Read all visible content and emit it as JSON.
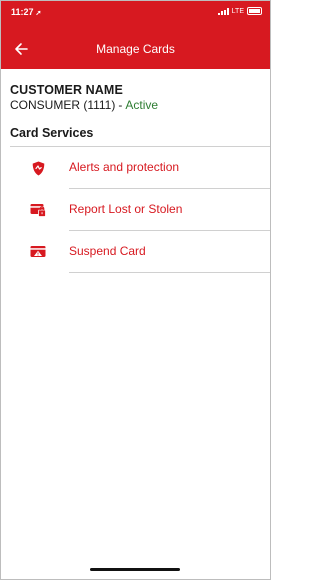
{
  "status_bar": {
    "time": "11:27",
    "network": "LTE"
  },
  "header": {
    "title": "Manage Cards"
  },
  "customer": {
    "name_label": "CUSTOMER NAME",
    "account": "CONSUMER (1111)",
    "separator": "-",
    "status": "Active"
  },
  "card_services": {
    "title": "Card Services",
    "items": [
      {
        "label": "Alerts and protection",
        "icon": "shield-icon"
      },
      {
        "label": "Report Lost or Stolen",
        "icon": "card-lock-icon"
      },
      {
        "label": "Suspend Card",
        "icon": "card-suspend-icon"
      }
    ]
  },
  "colors": {
    "brand_red": "#d71920",
    "active_green": "#2e7d32"
  }
}
